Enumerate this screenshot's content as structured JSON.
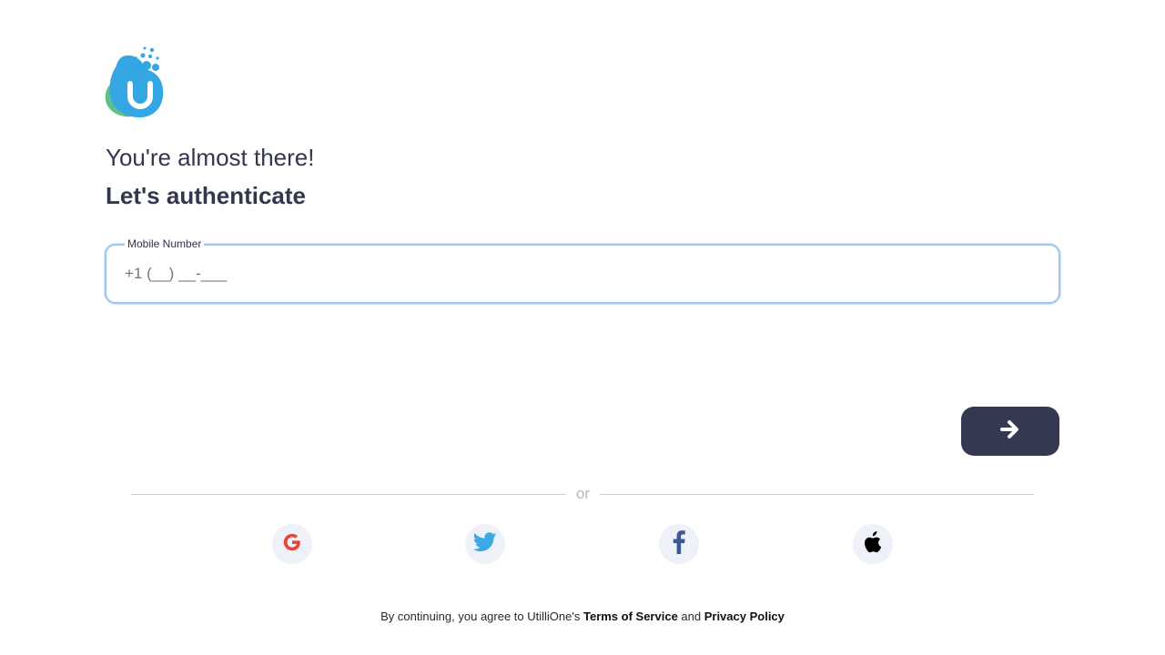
{
  "brand": {
    "logo_icon": "utillione-logo-icon",
    "logo_letter": "U",
    "colors": {
      "primary_blue": "#3aa3e3",
      "secondary_green": "#5cc08a",
      "dark": "#353851"
    }
  },
  "header": {
    "line1": "You're almost there!",
    "line2": "Let's authenticate"
  },
  "phone_field": {
    "label": "Mobile Number",
    "placeholder": "+1 (__) __-___",
    "value": ""
  },
  "next_button": {
    "icon": "arrow-right-icon"
  },
  "divider": {
    "text": "or"
  },
  "social_buttons": [
    {
      "provider": "Google",
      "icon": "google-icon"
    },
    {
      "provider": "Twitter",
      "icon": "twitter-icon"
    },
    {
      "provider": "Facebook",
      "icon": "facebook-icon"
    },
    {
      "provider": "Apple",
      "icon": "apple-icon"
    }
  ],
  "footer": {
    "prefix": "By continuing, you agree to UtilliOne's ",
    "terms_link": "Terms of Service",
    "conjunction": " and ",
    "privacy_link": "Privacy Policy"
  }
}
